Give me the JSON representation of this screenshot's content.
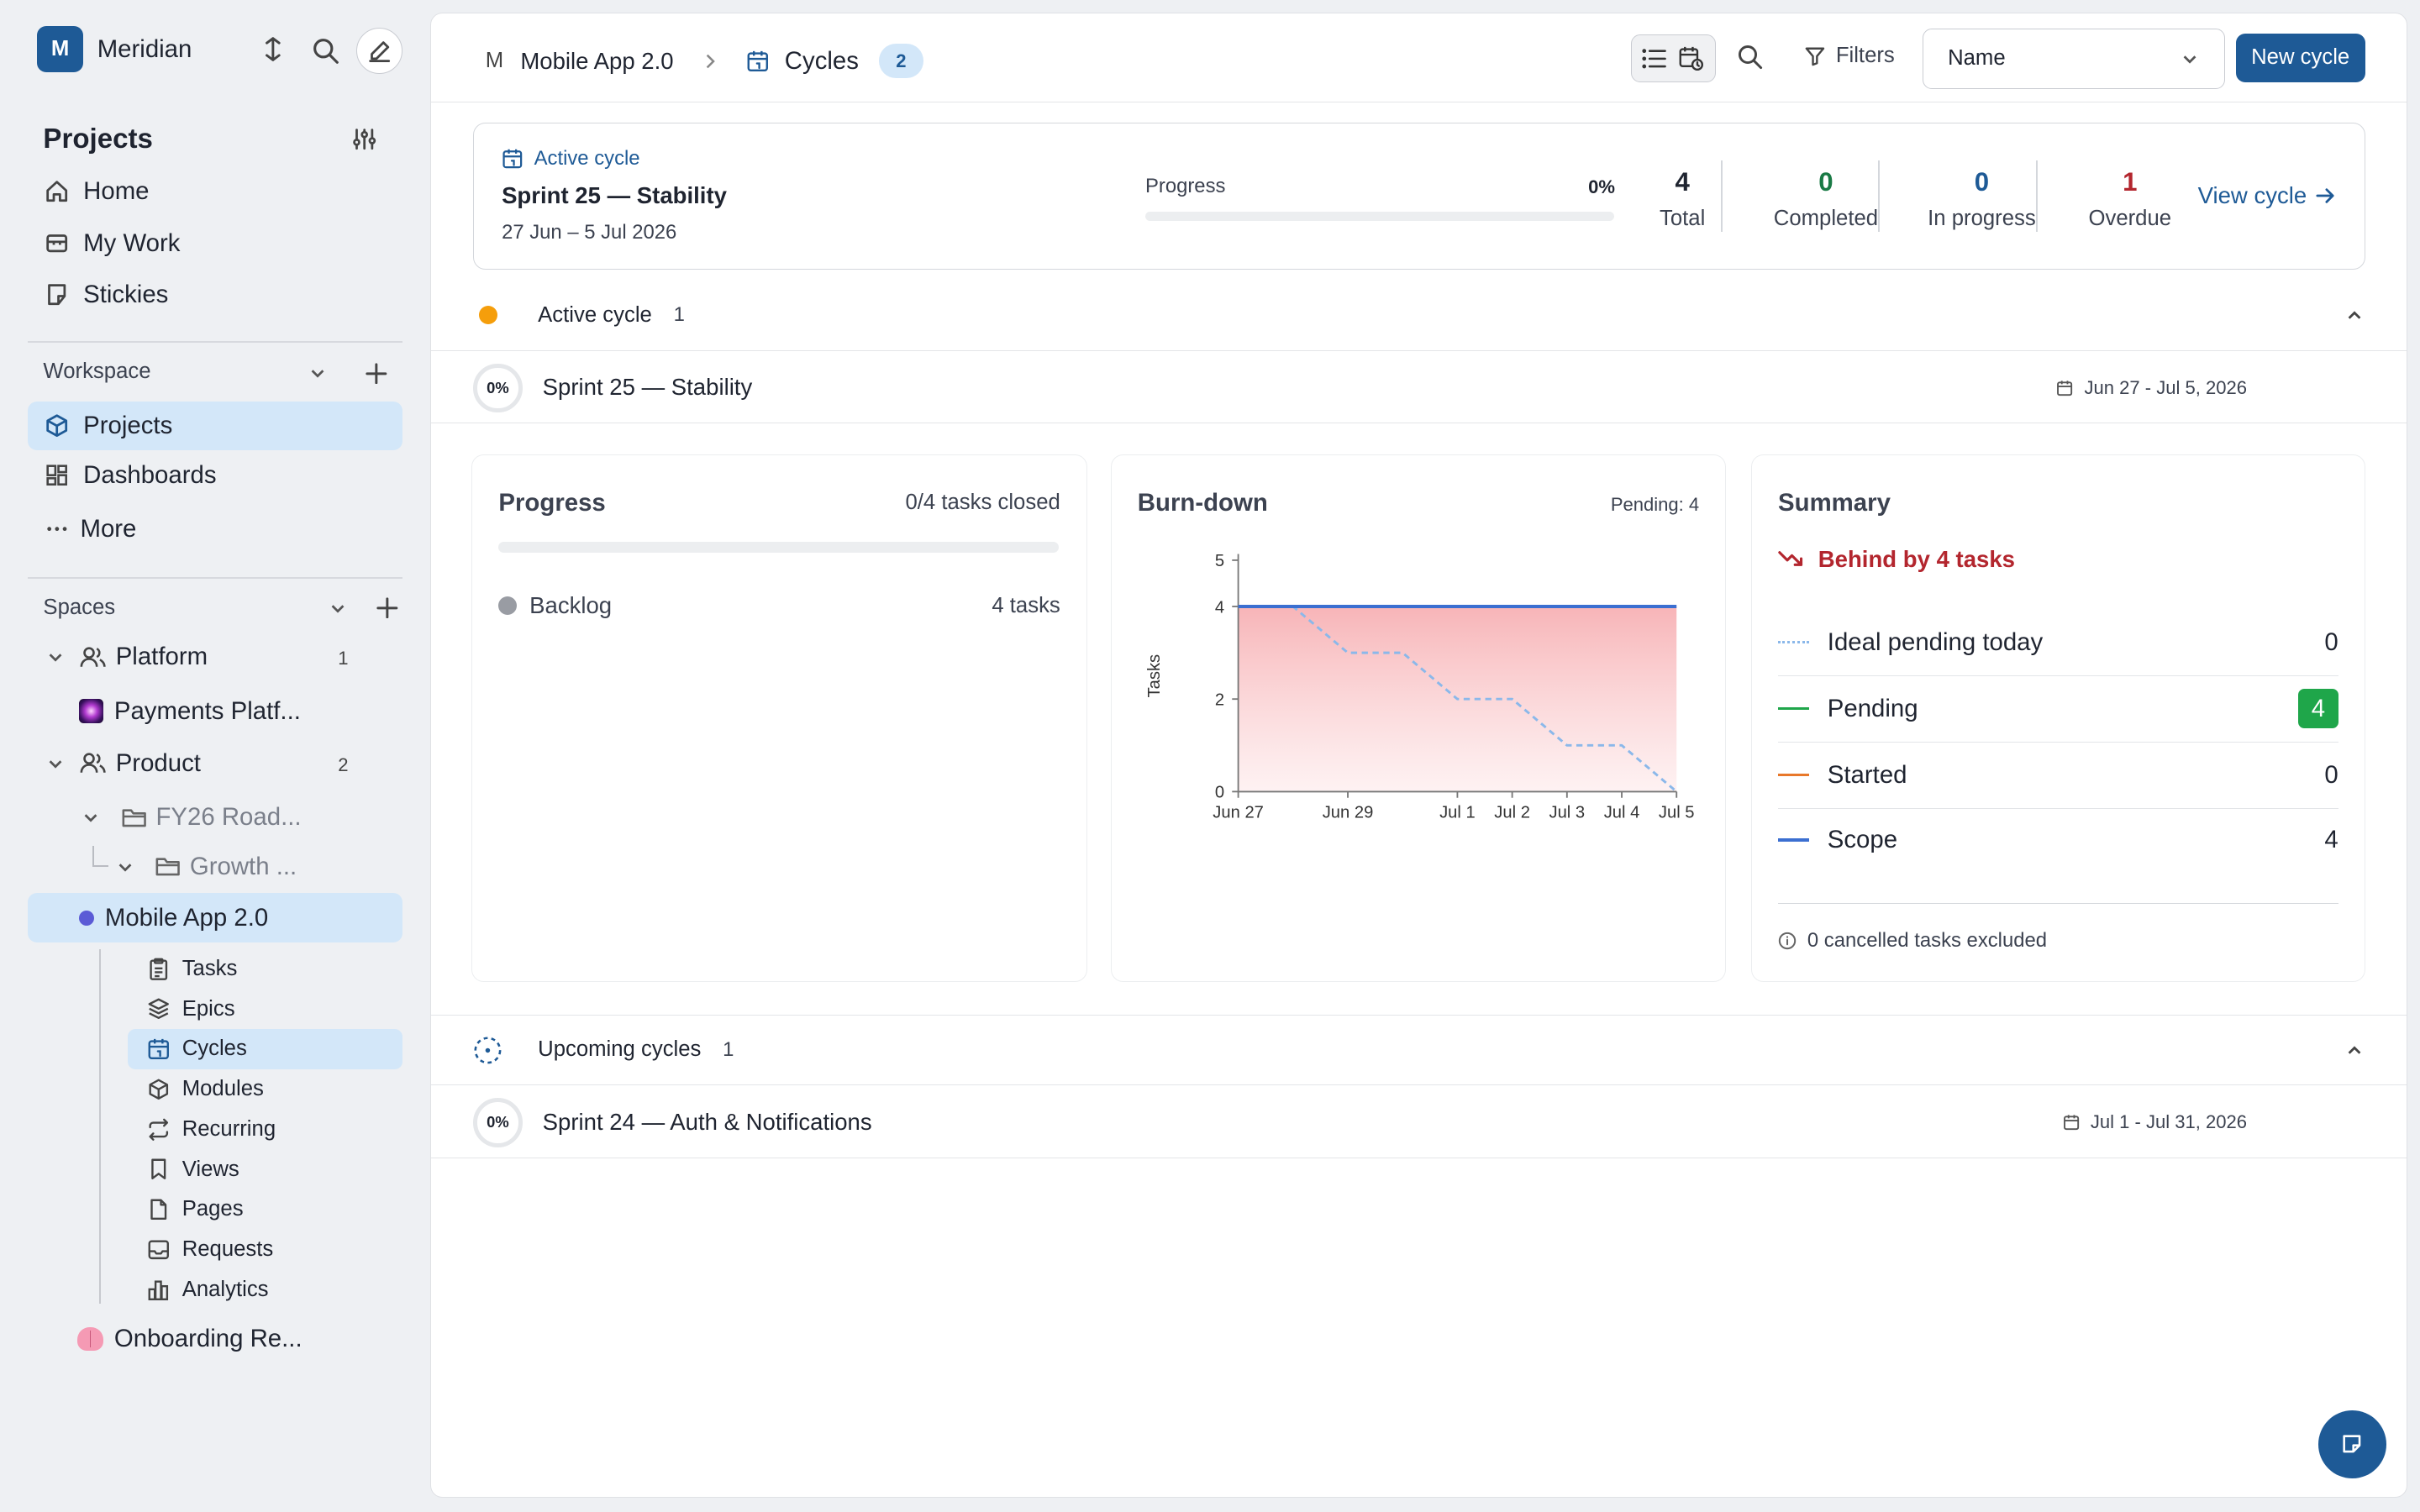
{
  "workspace": {
    "initial": "M",
    "name": "Meridian"
  },
  "sidebar": {
    "section_title": "Projects",
    "top_nav": [
      {
        "label": "Home",
        "icon": "home-icon"
      },
      {
        "label": "My Work",
        "icon": "briefcase-icon"
      },
      {
        "label": "Stickies",
        "icon": "sticky-note-icon"
      }
    ],
    "workspace_label": "Workspace",
    "workspace_nav": [
      {
        "label": "Projects",
        "icon": "box-icon",
        "active": true
      },
      {
        "label": "Dashboards",
        "icon": "dashboard-icon"
      },
      {
        "label": "More",
        "icon": "more-dots-icon"
      }
    ],
    "spaces_label": "Spaces",
    "spaces": {
      "platform": {
        "label": "Platform",
        "count": "1"
      },
      "payments": {
        "label": "Payments Platf..."
      },
      "product": {
        "label": "Product",
        "count": "2"
      },
      "fy26": {
        "label": "FY26 Road..."
      },
      "growth": {
        "label": "Growth ..."
      },
      "mobile": {
        "label": "Mobile App 2.0"
      },
      "onboarding": {
        "label": "Onboarding Re..."
      }
    },
    "project_items": [
      {
        "label": "Tasks",
        "icon": "clipboard-icon"
      },
      {
        "label": "Epics",
        "icon": "layers-icon"
      },
      {
        "label": "Cycles",
        "icon": "calendar-icon",
        "active": true
      },
      {
        "label": "Modules",
        "icon": "cube-icon"
      },
      {
        "label": "Recurring",
        "icon": "repeat-icon"
      },
      {
        "label": "Views",
        "icon": "bookmark-icon"
      },
      {
        "label": "Pages",
        "icon": "page-icon"
      },
      {
        "label": "Requests",
        "icon": "inbox-icon"
      },
      {
        "label": "Analytics",
        "icon": "bar-chart-icon"
      }
    ]
  },
  "header": {
    "project_initial": "M",
    "project_name": "Mobile App 2.0",
    "page_title": "Cycles",
    "page_count": "2",
    "filters_label": "Filters",
    "sort_value": "Name",
    "new_button": "New cycle"
  },
  "active_card": {
    "kicker": "Active cycle",
    "title": "Sprint 25 — Stability",
    "dates": "27 Jun – 5 Jul 2026",
    "progress_label": "Progress",
    "progress_pct": "0%",
    "progress_value": 0,
    "stats": [
      {
        "value": "4",
        "label": "Total",
        "color": "#1f2430"
      },
      {
        "value": "0",
        "label": "Completed",
        "color": "#1a7a45"
      },
      {
        "value": "0",
        "label": "In progress",
        "color": "#1e5a96"
      },
      {
        "value": "1",
        "label": "Overdue",
        "color": "#b3262e"
      }
    ],
    "view_link": "View cycle"
  },
  "active_section": {
    "label": "Active cycle",
    "count": "1",
    "row": {
      "pct": "0%",
      "title": "Sprint 25 — Stability",
      "dates": "Jun 27 - Jul 5, 2026"
    }
  },
  "progress_panel": {
    "title": "Progress",
    "summary": "0/4 tasks closed",
    "groups": [
      {
        "label": "Backlog",
        "value": "4 tasks"
      }
    ]
  },
  "burndown_panel": {
    "title": "Burn-down",
    "pending": "Pending: 4"
  },
  "chart_data": {
    "type": "line",
    "title": "Burn-down",
    "ylabel": "Tasks",
    "ylim": [
      0,
      5
    ],
    "y_ticks": [
      0,
      2,
      4,
      5
    ],
    "x_labels": [
      "Jun 27",
      "Jun 29",
      "Jul 1",
      "Jul 2",
      "Jul 3",
      "Jul 4",
      "Jul 5"
    ],
    "x_start": "2026-06-27",
    "x_end": "2026-07-05",
    "series": [
      {
        "name": "Scope",
        "color": "#3b6fd1",
        "x": [
          "2026-06-27",
          "2026-07-05"
        ],
        "values": [
          4,
          4
        ]
      },
      {
        "name": "Pending",
        "color": "#f4a3a8",
        "x": [
          "2026-06-27",
          "2026-07-05"
        ],
        "values": [
          4,
          4
        ]
      },
      {
        "name": "Ideal pending",
        "color": "#8bb8ea",
        "x": [
          "2026-06-27",
          "2026-06-28",
          "2026-06-29",
          "2026-06-30",
          "2026-07-01",
          "2026-07-02",
          "2026-07-03",
          "2026-07-04",
          "2026-07-05"
        ],
        "values": [
          4,
          4,
          3,
          3,
          2,
          2,
          1,
          1,
          0
        ]
      }
    ]
  },
  "summary_panel": {
    "title": "Summary",
    "status": "Behind by 4 tasks",
    "rows": [
      {
        "label": "Ideal pending today",
        "value": "0",
        "color": "#8bb8ea"
      },
      {
        "label": "Pending",
        "value": "4",
        "color": "#1fa64a"
      },
      {
        "label": "Started",
        "value": "0",
        "color": "#e8782a"
      },
      {
        "label": "Scope",
        "value": "4",
        "color": "#3b6fd1"
      }
    ],
    "footnote": "0 cancelled tasks excluded"
  },
  "upcoming_section": {
    "label": "Upcoming cycles",
    "count": "1",
    "row": {
      "pct": "0%",
      "title": "Sprint 24 — Auth & Notifications",
      "dates": "Jul 1 - Jul 31, 2026"
    }
  },
  "colors": {
    "accent": "#1e5a96",
    "active_bg": "#d3e7f9",
    "danger": "#b3262e",
    "success": "#1fa64a",
    "amber": "#f59e0b"
  }
}
